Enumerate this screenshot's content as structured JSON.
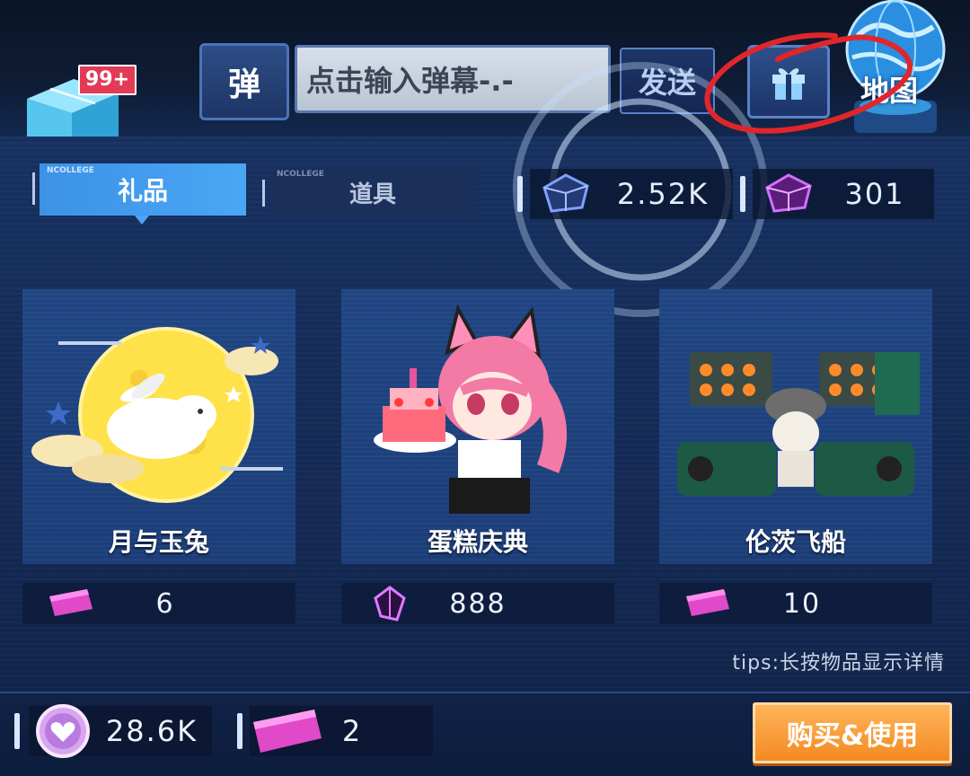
{
  "header": {
    "bag_badge": "99+",
    "bullet_label": "弹",
    "danmaku_placeholder": "点击输入弹幕-.-",
    "send_label": "发送",
    "map_label": "地图"
  },
  "tabs": [
    {
      "label": "礼品",
      "tag": "NCOLLEGE",
      "active": true
    },
    {
      "label": "道具",
      "tag": "NCOLLEGE",
      "active": false
    }
  ],
  "balances": {
    "blue_crystal": "2.52K",
    "purple_crystal": "301"
  },
  "items": [
    {
      "name": "月与玉兔",
      "price": "6",
      "currency_icon": "ticket-icon"
    },
    {
      "name": "蛋糕庆典",
      "price": "888",
      "currency_icon": "crystal-icon"
    },
    {
      "name": "伦茨飞船",
      "price": "10",
      "currency_icon": "ticket-icon"
    }
  ],
  "tips": "tips:长按物品显示详情",
  "wallet": {
    "heart_coin": "28.6K",
    "ticket": "2"
  },
  "buy_label": "购买&使用",
  "colors": {
    "accent_blue": "#4aa6f5",
    "buy_orange": "#f48a22",
    "annotation_red": "#e0262b"
  }
}
